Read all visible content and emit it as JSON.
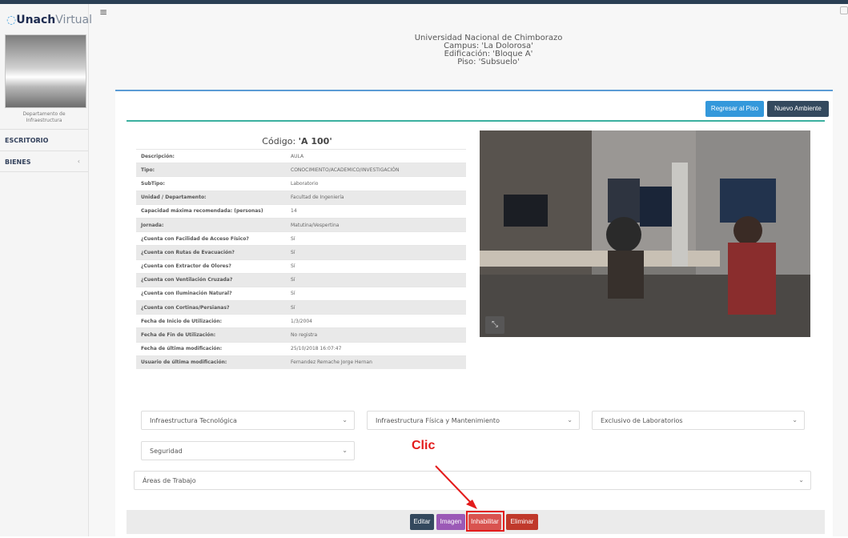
{
  "brand": {
    "name_bold": "Unach",
    "name_light": "Virtual"
  },
  "sidebar": {
    "department": [
      "Departamento de",
      "Infraestructura"
    ],
    "items": [
      {
        "label": "ESCRITORIO"
      },
      {
        "label": "BIENES"
      }
    ]
  },
  "header": {
    "lines": [
      "Universidad Nacional de Chimborazo",
      "Campus: 'La Dolorosa'",
      "Edificación: 'Bloque A'",
      "Piso: 'Subsuelo'"
    ]
  },
  "actions": {
    "back": "Regresar al Piso",
    "new": "Nuevo Ambiente"
  },
  "record": {
    "code_label": "Código:",
    "code_value": "'A 100'",
    "rows": [
      {
        "k": "Descripción:",
        "v": "AULA"
      },
      {
        "k": "Tipo:",
        "v": "CONOCIMIENTO/ACADEMICO/INVESTIGACIÓN"
      },
      {
        "k": "SubTipo:",
        "v": "Laboratorio"
      },
      {
        "k": "Unidad / Departamento:",
        "v": "Facultad de Ingeniería"
      },
      {
        "k": "Capacidad máxima recomendada: (personas)",
        "v": "14"
      },
      {
        "k": "Jornada:",
        "v": "Matutina/Vespertina"
      },
      {
        "k": "¿Cuenta con Facilidad de Acceso Físico?",
        "v": "Sí"
      },
      {
        "k": "¿Cuenta con Rutas de Evacuación?",
        "v": "Sí"
      },
      {
        "k": "¿Cuenta con Extractor de Olores?",
        "v": "Sí"
      },
      {
        "k": "¿Cuenta con Ventilación Cruzada?",
        "v": "Sí"
      },
      {
        "k": "¿Cuenta con Iluminación Natural?",
        "v": "Sí"
      },
      {
        "k": "¿Cuenta con Cortinas/Persianas?",
        "v": "Sí"
      },
      {
        "k": "Fecha de Inicio de Utilización:",
        "v": "1/3/2004"
      },
      {
        "k": "Fecha de Fin de Utilización:",
        "v": "No registra"
      },
      {
        "k": "Fecha de última modificación:",
        "v": "25/10/2018 16:07:47"
      },
      {
        "k": "Usuario de última modificación:",
        "v": "Fernandez Remache Jorge Hernan"
      }
    ]
  },
  "sections": [
    "Infraestructura Tecnológica",
    "Infraestructura Física y Mantenimiento",
    "Exclusivo de Laboratorios",
    "Seguridad",
    "Áreas de Trabajo"
  ],
  "footer": {
    "edit": "Editar",
    "image": "Imagen",
    "disable": "Inhabilitar",
    "delete": "Eliminar"
  },
  "annotation": {
    "text": "Clic"
  },
  "colors": {
    "accent": "#3498db",
    "dark": "#34495e",
    "purple": "#9b59b6",
    "red": "#d9534f",
    "annotation": "#e31b1b"
  }
}
